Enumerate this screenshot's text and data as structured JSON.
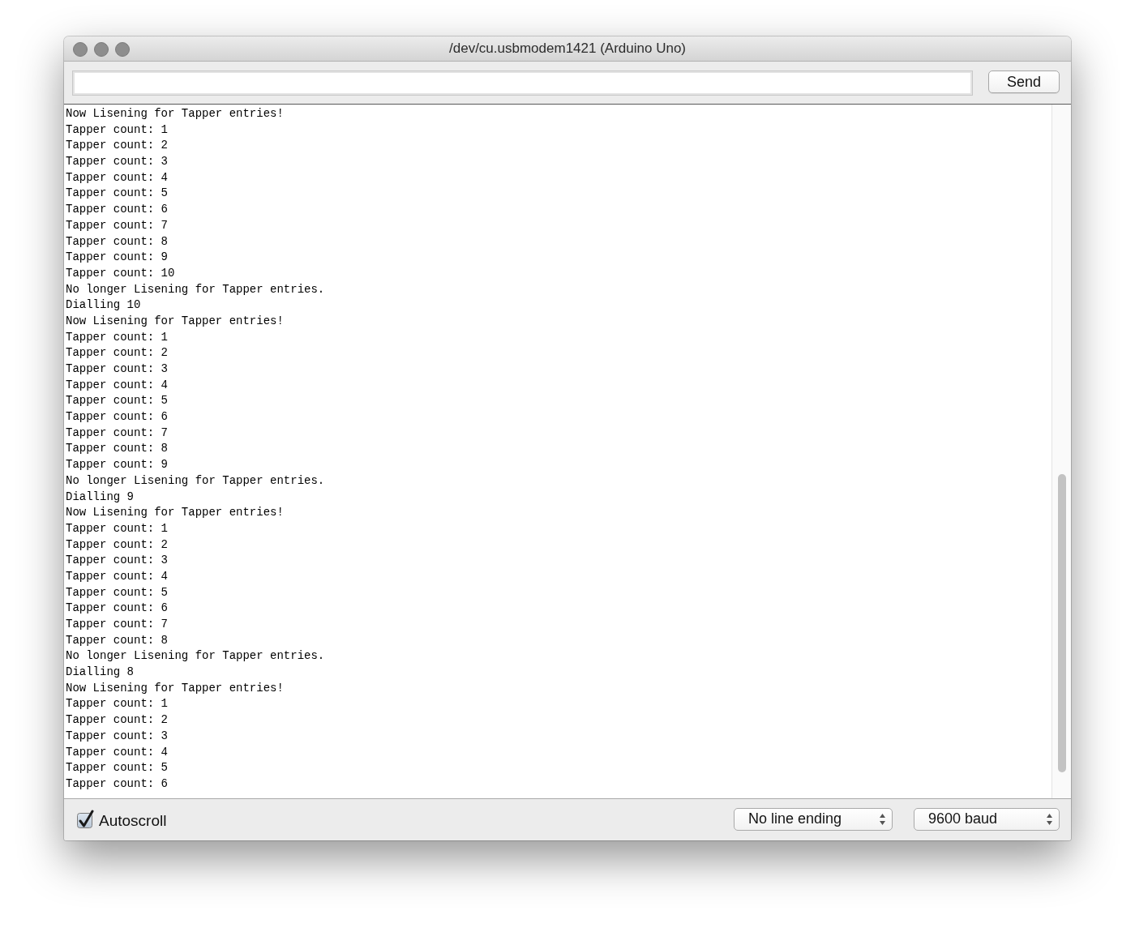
{
  "window": {
    "title": "/dev/cu.usbmodem1421 (Arduino Uno)"
  },
  "toolbar": {
    "send_button": "Send"
  },
  "console": {
    "lines": [
      "Now Lisening for Tapper entries!",
      "Tapper count: 1",
      "Tapper count: 2",
      "Tapper count: 3",
      "Tapper count: 4",
      "Tapper count: 5",
      "Tapper count: 6",
      "Tapper count: 7",
      "Tapper count: 8",
      "Tapper count: 9",
      "Tapper count: 10",
      "No longer Lisening for Tapper entries.",
      "Dialling 10",
      "Now Lisening for Tapper entries!",
      "Tapper count: 1",
      "Tapper count: 2",
      "Tapper count: 3",
      "Tapper count: 4",
      "Tapper count: 5",
      "Tapper count: 6",
      "Tapper count: 7",
      "Tapper count: 8",
      "Tapper count: 9",
      "No longer Lisening for Tapper entries.",
      "Dialling 9",
      "Now Lisening for Tapper entries!",
      "Tapper count: 1",
      "Tapper count: 2",
      "Tapper count: 3",
      "Tapper count: 4",
      "Tapper count: 5",
      "Tapper count: 6",
      "Tapper count: 7",
      "Tapper count: 8",
      "No longer Lisening for Tapper entries.",
      "Dialling 8",
      "Now Lisening for Tapper entries!",
      "Tapper count: 1",
      "Tapper count: 2",
      "Tapper count: 3",
      "Tapper count: 4",
      "Tapper count: 5",
      "Tapper count: 6"
    ]
  },
  "footer": {
    "autoscroll": {
      "label": "Autoscroll",
      "checked": true
    },
    "line_ending": {
      "value": "No line ending"
    },
    "baud_rate": {
      "value": "9600 baud"
    }
  }
}
